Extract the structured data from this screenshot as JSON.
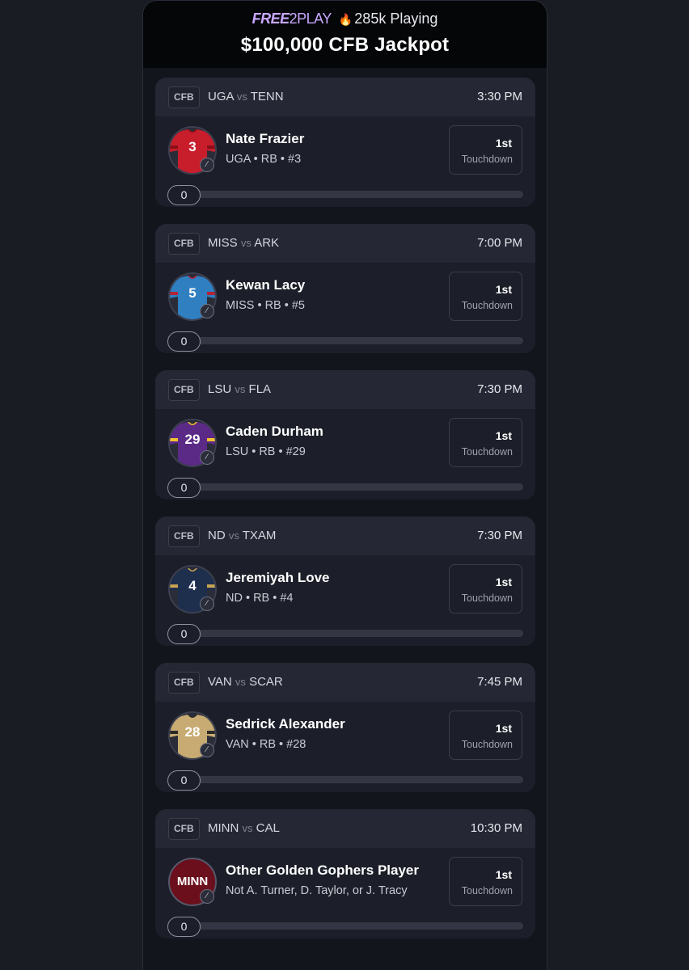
{
  "header": {
    "free_label": "FREE",
    "twoplay_label": "2PLAY",
    "flame_icon": "flame-icon",
    "playing_text": "285k Playing",
    "title": "$100,000 CFB Jackpot"
  },
  "games": [
    {
      "league": "CFB",
      "team1": "UGA",
      "vs": "vs",
      "team2": "TENN",
      "time": "3:30 PM",
      "player": "Nate Frazier",
      "detail": "UGA • RB • #3",
      "jersey_number": "3",
      "jersey_color": "#c81e2c",
      "jersey_accent": "#8a0f18",
      "number_color": "#ffffff",
      "prop_rank": "1st",
      "prop_label": "Touchdown",
      "progress": "0",
      "progress_fraction": 0
    },
    {
      "league": "CFB",
      "team1": "MISS",
      "vs": "vs",
      "team2": "ARK",
      "time": "7:00 PM",
      "player": "Kewan Lacy",
      "detail": "MISS • RB • #5",
      "jersey_number": "5",
      "jersey_color": "#2f7fc1",
      "jersey_accent": "#b3233a",
      "number_color": "#ffffff",
      "prop_rank": "1st",
      "prop_label": "Touchdown",
      "progress": "0",
      "progress_fraction": 0
    },
    {
      "league": "CFB",
      "team1": "LSU",
      "vs": "vs",
      "team2": "FLA",
      "time": "7:30 PM",
      "player": "Caden Durham",
      "detail": "LSU • RB • #29",
      "jersey_number": "29",
      "jersey_color": "#5b2a86",
      "jersey_accent": "#f2c230",
      "number_color": "#ffffff",
      "prop_rank": "1st",
      "prop_label": "Touchdown",
      "progress": "0",
      "progress_fraction": 0
    },
    {
      "league": "CFB",
      "team1": "ND",
      "vs": "vs",
      "team2": "TXAM",
      "time": "7:30 PM",
      "player": "Jeremiyah Love",
      "detail": "ND • RB • #4",
      "jersey_number": "4",
      "jersey_color": "#1e2f4e",
      "jersey_accent": "#c9a451",
      "number_color": "#ffffff",
      "prop_rank": "1st",
      "prop_label": "Touchdown",
      "progress": "0",
      "progress_fraction": 0
    },
    {
      "league": "CFB",
      "team1": "VAN",
      "vs": "vs",
      "team2": "SCAR",
      "time": "7:45 PM",
      "player": "Sedrick Alexander",
      "detail": "VAN • RB • #28",
      "jersey_number": "28",
      "jersey_color": "#c7ab72",
      "jersey_accent": "#2a2a2a",
      "number_color": "#ffffff",
      "prop_rank": "1st",
      "prop_label": "Touchdown",
      "progress": "0",
      "progress_fraction": 0
    },
    {
      "league": "CFB",
      "team1": "MINN",
      "vs": "vs",
      "team2": "CAL",
      "time": "10:30 PM",
      "player": "Other Golden Gophers Player",
      "detail": "Not A. Turner, D. Taylor, or J. Tracy",
      "avatar_text": "MINN",
      "prop_rank": "1st",
      "prop_label": "Touchdown",
      "progress": "0",
      "progress_fraction": 0
    }
  ]
}
